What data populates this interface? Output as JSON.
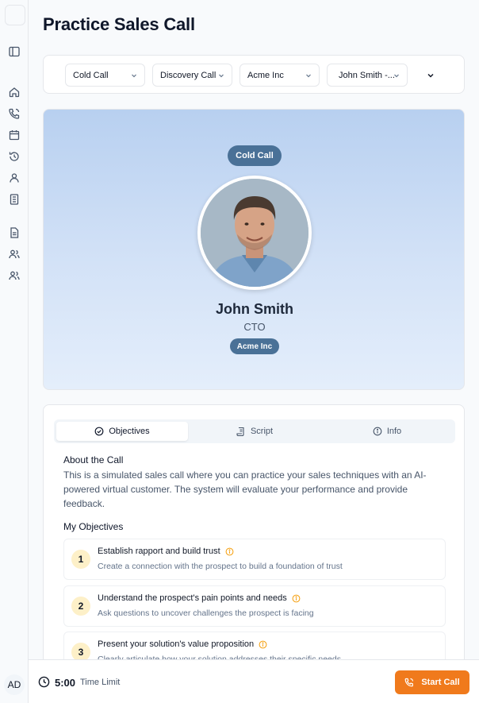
{
  "sidebar": {
    "icons": [
      "panel-toggle-icon",
      "home-icon",
      "phone-call-icon",
      "calendar-icon",
      "history-icon",
      "user-icon",
      "building-icon",
      "document-icon",
      "users-icon",
      "users-group-icon"
    ],
    "avatar_initials": "AD"
  },
  "page": {
    "title": "Practice Sales Call"
  },
  "filters": {
    "call_type": "Cold Call",
    "call_stage": "Discovery Call",
    "company": "Acme Inc",
    "persona": "John Smith -..."
  },
  "persona": {
    "call_type_badge": "Cold Call",
    "name": "John Smith",
    "role": "CTO",
    "company_badge": "Acme Inc"
  },
  "tabs": [
    {
      "label": "Objectives",
      "icon": "check-circle-icon",
      "active": true
    },
    {
      "label": "Script",
      "icon": "script-icon",
      "active": false
    },
    {
      "label": "Info",
      "icon": "info-icon",
      "active": false
    }
  ],
  "about": {
    "heading": "About the Call",
    "text": "This is a simulated sales call where you can practice your sales techniques with an AI-powered virtual customer. The system will evaluate your performance and provide feedback."
  },
  "objectives": {
    "heading": "My Objectives",
    "items": [
      {
        "num": "1",
        "title": "Establish rapport and build trust",
        "desc": "Create a connection with the prospect to build a foundation of trust"
      },
      {
        "num": "2",
        "title": "Understand the prospect's pain points and needs",
        "desc": "Ask questions to uncover challenges the prospect is facing"
      },
      {
        "num": "3",
        "title": "Present your solution's value proposition",
        "desc": "Clearly articulate how your solution addresses their specific needs"
      }
    ]
  },
  "footer": {
    "time_value": "5:00",
    "time_label": "Time Limit",
    "start_button": "Start Call"
  },
  "colors": {
    "accent": "#f07a1c",
    "badge": "#4a7197",
    "hero_top": "#b8d0f0",
    "number_bg": "#fdf0c8"
  }
}
